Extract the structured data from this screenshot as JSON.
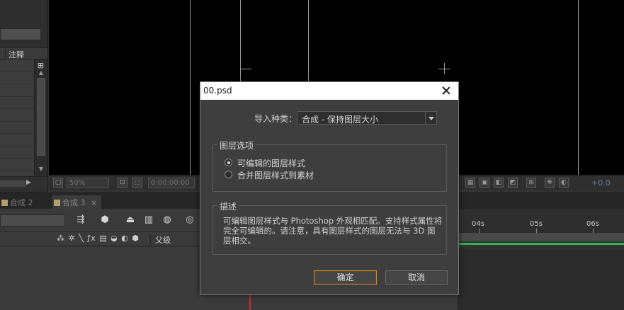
{
  "project_panel": {
    "column_comment": "注释"
  },
  "viewer": {
    "zoom": "50%",
    "timecode": "0:00:00:00",
    "exposure": "+0.0"
  },
  "timeline": {
    "tabs": [
      {
        "label": "合成 2",
        "active": false
      },
      {
        "label": "合成 3",
        "active": true
      }
    ],
    "parent_column": "父级",
    "ruler_labels": [
      "04s",
      "05s",
      "06s"
    ],
    "label_color": "#b39d72",
    "work_area_color": "#2fb44e"
  },
  "dialog": {
    "title": "00.psd",
    "import_kind_label": "导入种类：",
    "import_kind_value": "合成 - 保持图层大小",
    "layer_options_title": "图层选项",
    "options": [
      {
        "label": "可编辑的图层样式",
        "selected": true
      },
      {
        "label": "合并图层样式到素材",
        "selected": false
      }
    ],
    "description_title": "描述",
    "description_text": "可编辑图层样式与 Photoshop 外观相匹配。支持样式属性将完全可编辑的。请注意，具有图层样式的图层无法与 3D 图层相交。",
    "ok_label": "确定",
    "cancel_label": "取消",
    "accent_color": "#d08a2a"
  }
}
